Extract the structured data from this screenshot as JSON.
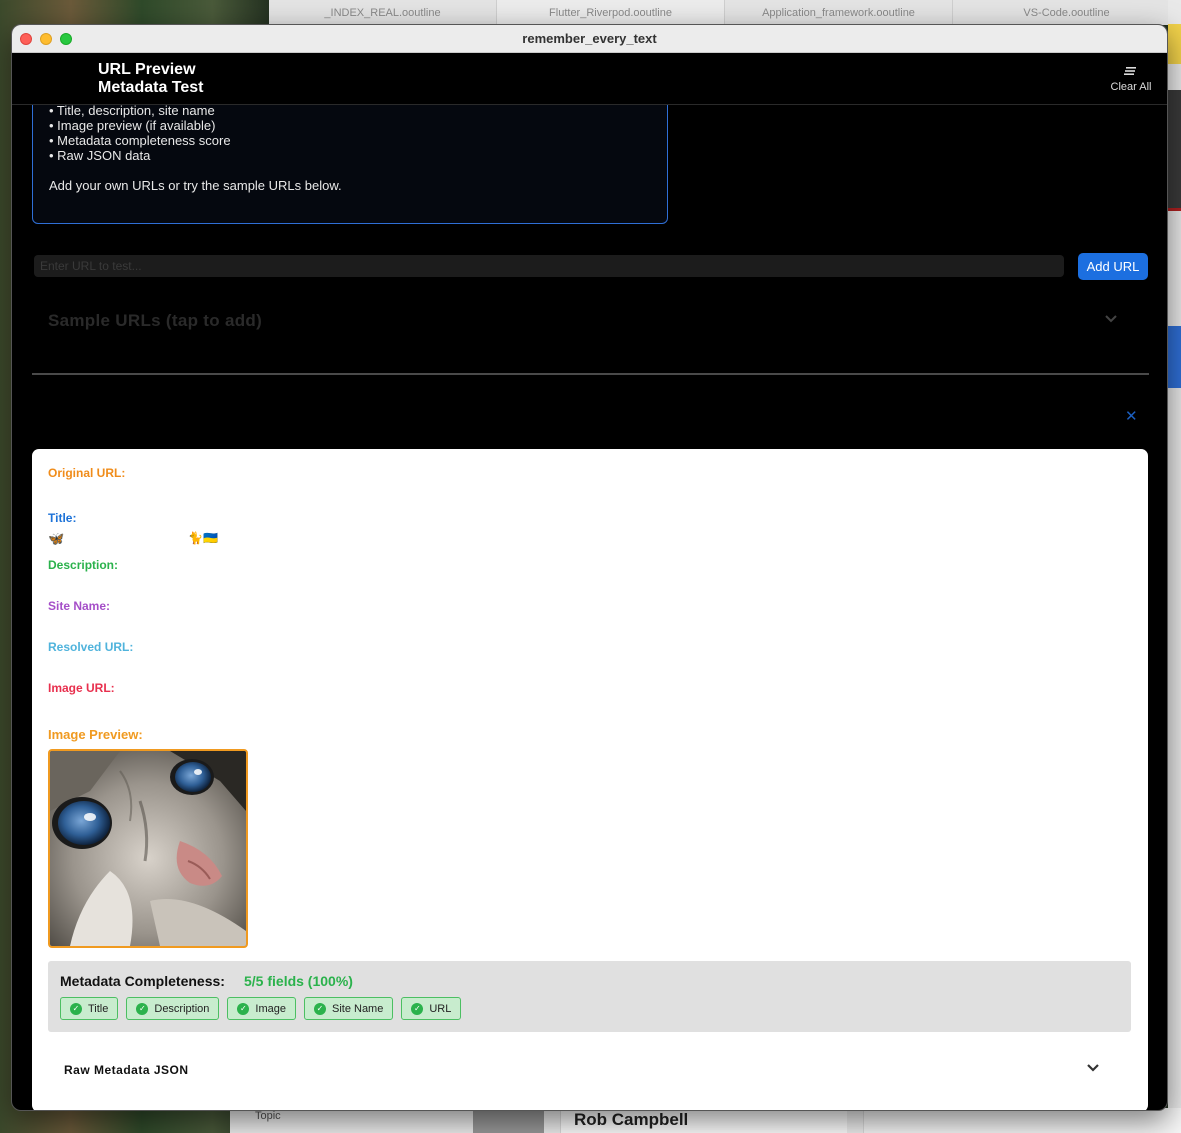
{
  "background": {
    "tabs": [
      "_INDEX_REAL.ooutline",
      "Flutter_Riverpod.ooutline",
      "Application_framework.ooutline",
      "VS-Code.ooutline"
    ],
    "bottom_name": "Rob Campbell",
    "bottom_topic": "Topic"
  },
  "window": {
    "title": "remember_every_text"
  },
  "appbar": {
    "title": "URL Preview Metadata Test",
    "clear_all_label": "Clear All",
    "clear_all_icon": "clear-all-icon"
  },
  "info": {
    "lines": [
      "• Title, description, site name",
      "• Image preview (if available)",
      "• Metadata completeness score",
      "• Raw JSON data",
      "Add your own URLs or try the sample URLs below."
    ]
  },
  "url_input": {
    "placeholder": "Enter URL to test...",
    "value": ""
  },
  "add_url_button": "Add URL",
  "sample_urls_label": "Sample URLs (tap to add)",
  "result": {
    "labels": {
      "original_url": "Original URL:",
      "title": "Title:",
      "description": "Description:",
      "site_name": "Site Name:",
      "resolved_url": "Resolved URL:",
      "image_url": "Image URL:",
      "image_preview": "Image Preview:"
    },
    "title_emoji_1": "🦋",
    "title_emoji_2": "🐈🇺🇦",
    "completeness_label": "Metadata Completeness:",
    "completeness_value": "5/5 fields (100%)",
    "chips": [
      "Title",
      "Description",
      "Image",
      "Site Name",
      "URL"
    ],
    "raw_json_label": "Raw Metadata JSON"
  },
  "colors": {
    "original_url": "#f08c1a",
    "title": "#1c72d8",
    "description": "#2bb24c",
    "site_name": "#a54ec8",
    "resolved_url": "#4fb3dc",
    "image_url": "#e8304e",
    "accent_button": "#1c6fe0"
  }
}
